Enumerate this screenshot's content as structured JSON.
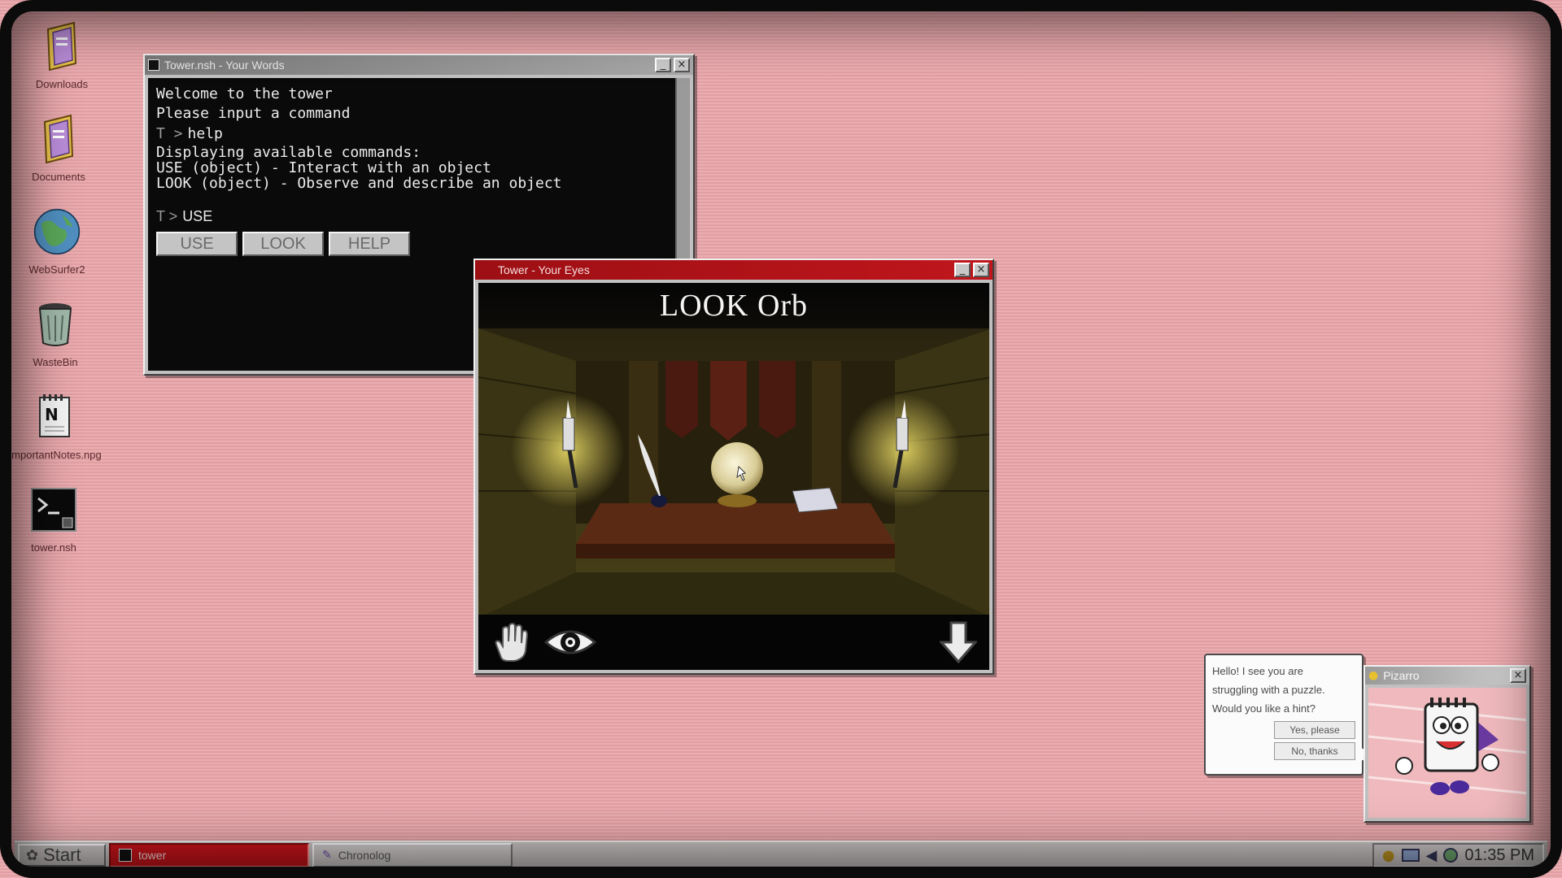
{
  "desktop": {
    "icons": [
      {
        "label": "Downloads"
      },
      {
        "label": "Documents"
      },
      {
        "label": "WebSurfer2"
      },
      {
        "label": "WasteBin"
      },
      {
        "label": "importantNotes.npg"
      },
      {
        "label": "tower.nsh"
      }
    ]
  },
  "terminal": {
    "title": "Tower.nsh - Your Words",
    "lines": [
      "Welcome to the tower",
      "Please input a command"
    ],
    "prompt_symbol": "T >",
    "history_command": "help",
    "help_output": [
      "Displaying available commands:",
      "USE (object) - Interact with an object",
      "LOOK (object) - Observe and describe an object"
    ],
    "current_input": "USE",
    "buttons": [
      "USE",
      "LOOK",
      "HELP"
    ]
  },
  "eyes": {
    "title": "Tower - Your Eyes",
    "scene_heading": "LOOK Orb",
    "actions": {
      "use_icon": "hand-icon",
      "look_icon": "eye-icon",
      "back_icon": "down-arrow-icon"
    }
  },
  "assistant": {
    "title": "Pizarro",
    "message": [
      "Hello! I see you are",
      "struggling with a puzzle.",
      "Would you like a hint?"
    ],
    "options": [
      "Yes, please",
      "No, thanks"
    ]
  },
  "taskbar": {
    "start_label": "Start",
    "tasks": [
      {
        "label": "tower",
        "active": true
      },
      {
        "label": "Chronolog",
        "active": false
      }
    ],
    "clock": "01:35 PM"
  },
  "colors": {
    "desktop_bg": "#e8a4a8",
    "active_title": "#c0161c",
    "terminal_bg": "#0a0a0a"
  }
}
